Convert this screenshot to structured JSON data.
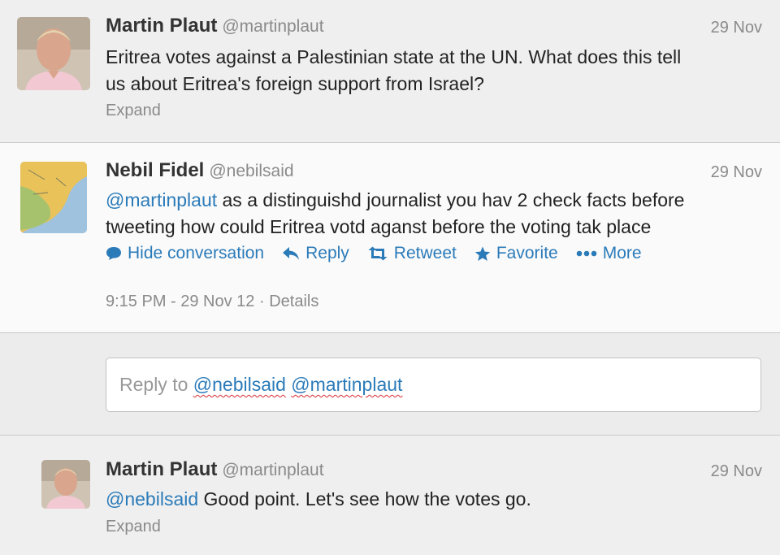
{
  "tweet1": {
    "name": "Martin Plaut",
    "handle": "@martinplaut",
    "date": "29 Nov",
    "line1": "Eritrea votes against a Palestinian state at the UN. What does this tell",
    "line2": "us about Eritrea's foreign support from Israel?",
    "expand": "Expand"
  },
  "tweet2": {
    "name": "Nebil Fidel",
    "handle": "@nebilsaid",
    "date": "29 Nov",
    "mention": "@martinplaut",
    "line1_rest": " as a distinguishd journalist you hav 2 check facts before",
    "line2": "tweeting how could Eritrea votd aganst before the voting tak place",
    "actions": {
      "hide": "Hide conversation",
      "reply": "Reply",
      "retweet": "Retweet",
      "favorite": "Favorite",
      "more": "More"
    },
    "meta_time": "9:15 PM - 29 Nov 12",
    "meta_sep": " · ",
    "meta_details": "Details"
  },
  "reply": {
    "prefix": "Reply to ",
    "mention1": "@nebilsaid",
    "mention2": "@martinplaut"
  },
  "tweet3": {
    "name": "Martin Plaut",
    "handle": "@martinplaut",
    "date": "29 Nov",
    "mention": "@nebilsaid",
    "text_rest": " Good point. Let's see how the votes go.",
    "expand": "Expand"
  },
  "colors": {
    "link": "#2b7bb9",
    "muted": "#8a8a8a",
    "spellcheck": "#d9282d"
  },
  "icons": [
    "speech-bubble-icon",
    "reply-arrow-icon",
    "retweet-icon",
    "star-icon",
    "more-dots-icon"
  ]
}
